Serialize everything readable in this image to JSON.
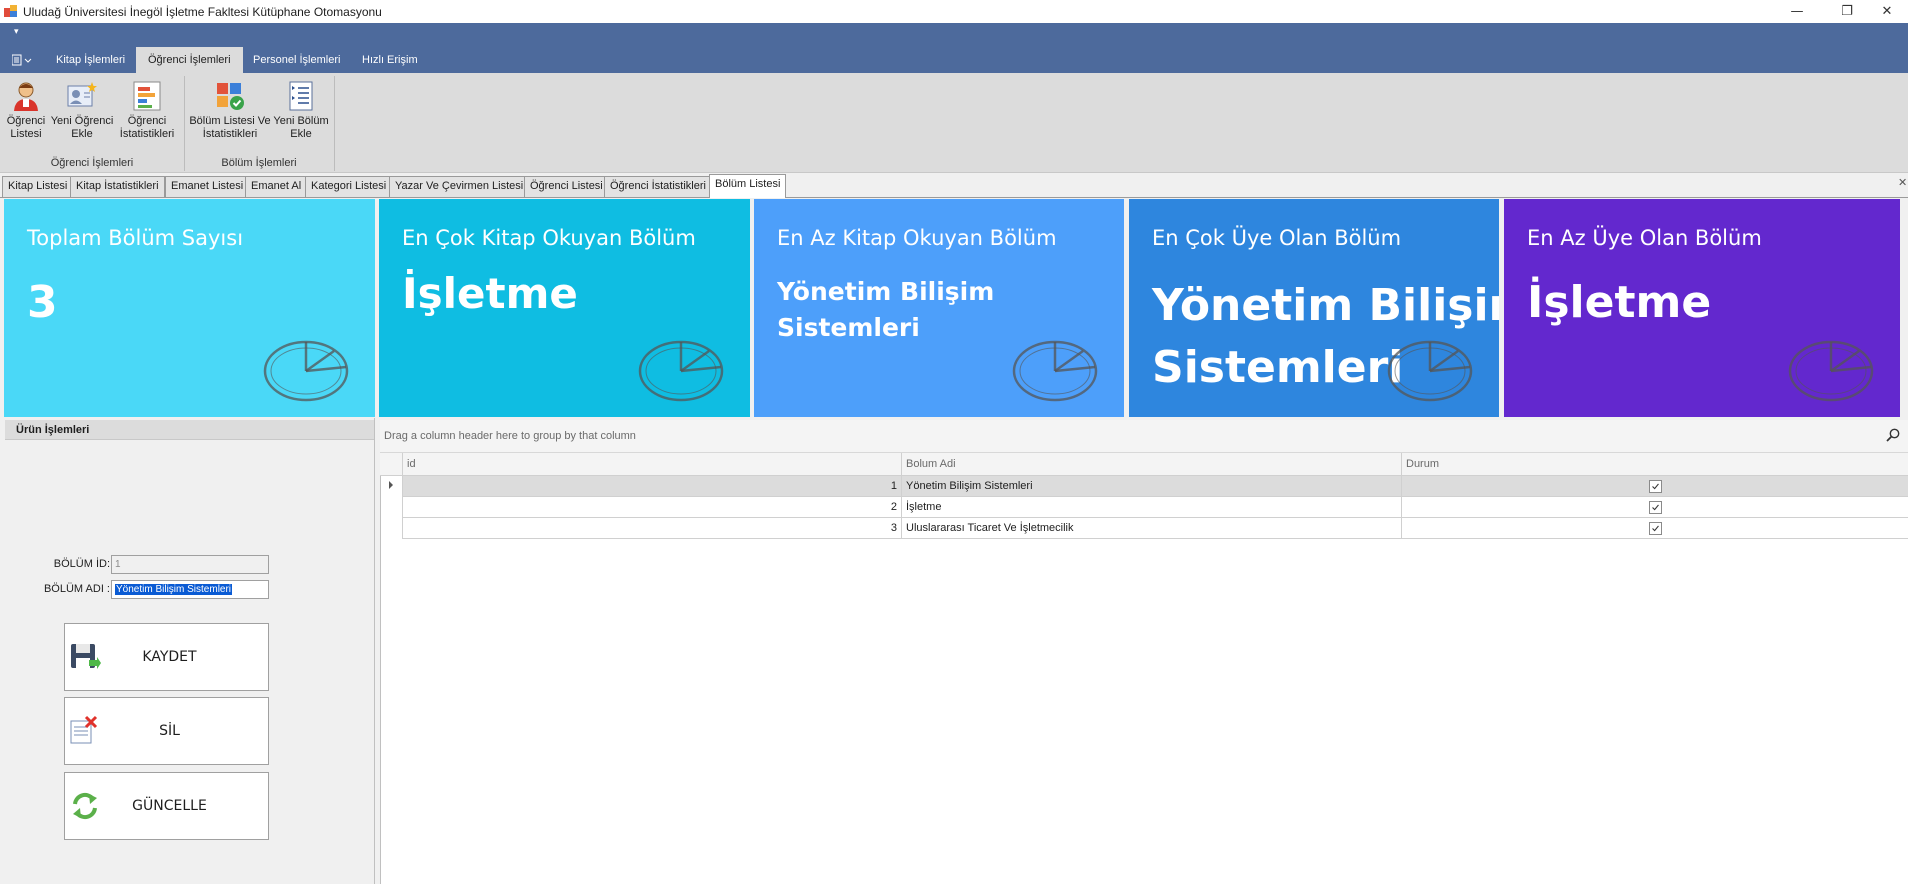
{
  "window": {
    "title": "Uludağ Üniversitesi İnegöl İşletme Fakltesi Kütüphane Otomasyonu",
    "minimize": "—",
    "restore": "❐",
    "close": "✕"
  },
  "ribbon": {
    "qat_glyph": "▾",
    "tabs": [
      "Kitap İşlemleri",
      "Öğrenci İşlemleri",
      "Personel İşlemleri",
      "Hızlı Erişim"
    ],
    "active_tab": "Öğrenci İşlemleri",
    "groups": [
      {
        "label": "Öğrenci İşlemleri",
        "buttons": [
          {
            "line1": "Öğrenci",
            "line2": "Listesi",
            "icon": "student-icon"
          },
          {
            "line1": "Yeni Öğrenci",
            "line2": "Ekle",
            "icon": "add-student-icon"
          },
          {
            "line1": "Öğrenci",
            "line2": "İstatistikleri",
            "icon": "statistics-icon"
          }
        ]
      },
      {
        "label": "Bölüm İşlemleri",
        "buttons": [
          {
            "line1": "Bölüm Listesi Ve",
            "line2": "İstatistikleri",
            "icon": "department-list-icon"
          },
          {
            "line1": "Yeni Bölüm",
            "line2": "Ekle",
            "icon": "add-department-icon"
          }
        ]
      }
    ]
  },
  "doc_tabs": [
    "Kitap Listesi",
    "Kitap İstatistikleri",
    "Emanet Listesi",
    "Emanet Al",
    "Kategori Listesi",
    "Yazar Ve Çevirmen Listesi",
    "Öğrenci Listesi",
    "Öğrenci İstatistikleri",
    "Bölüm Listesi"
  ],
  "active_doc_tab": "Bölüm Listesi",
  "tiles": [
    {
      "title": "Toplam Bölüm Sayısı",
      "value": "3",
      "color": "#4ad8f7"
    },
    {
      "title": "En Çok Kitap Okuyan Bölüm",
      "value": "İşletme",
      "color": "#0fbde2"
    },
    {
      "title": "En Az Kitap Okuyan Bölüm",
      "value_line1": "Yönetim Bilişim",
      "value_line2": "Sistemleri",
      "color": "#4d9ffa"
    },
    {
      "title": "En Çok Üye Olan Bölüm",
      "value_line1": "Yönetim Bilişim",
      "value_line2": "Sistemleri",
      "color": "#2e86de"
    },
    {
      "title": "En Az Üye Olan Bölüm",
      "value": "İşletme",
      "color": "#6328ce"
    }
  ],
  "form": {
    "panel_title": "Ürün İşlemleri",
    "id_label": "BÖLÜM İD:",
    "id_value": "1",
    "name_label": "BÖLÜM ADI :",
    "name_value": "Yönetim Bilişim Sistemleri",
    "save_label": "KAYDET",
    "delete_label": "SİL",
    "update_label": "GÜNCELLE"
  },
  "grid": {
    "group_hint": "Drag a column header here to group by that column",
    "columns": [
      "id",
      "Bolum Adi",
      "Durum"
    ],
    "rows": [
      {
        "id": "1",
        "name": "Yönetim Bilişim Sistemleri",
        "durum": true
      },
      {
        "id": "2",
        "name": "İşletme",
        "durum": true
      },
      {
        "id": "3",
        "name": "Uluslararası Ticaret Ve İşletmecilik",
        "durum": true
      }
    ]
  }
}
